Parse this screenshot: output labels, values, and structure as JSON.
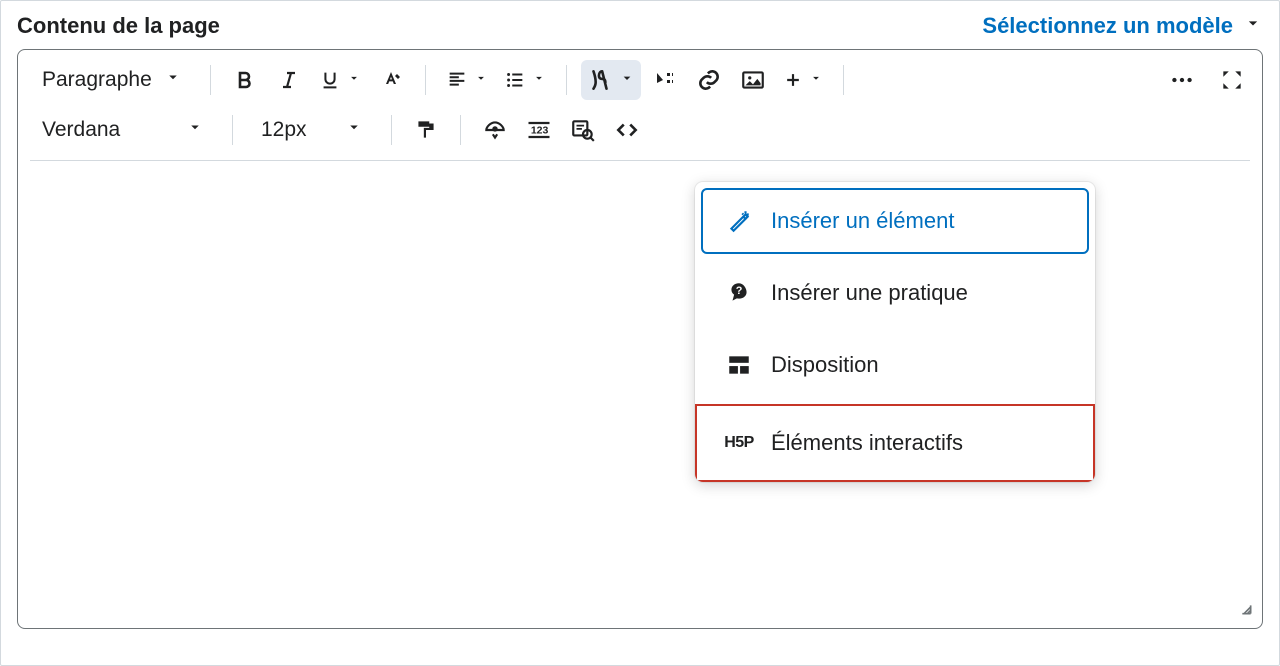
{
  "header": {
    "title": "Contenu de la page",
    "template_link": "Sélectionnez un modèle"
  },
  "toolbar": {
    "paragraph": "Paragraphe",
    "font_family": "Verdana",
    "font_size": "12px"
  },
  "insert_menu": {
    "items": [
      {
        "label": "Insérer un élément"
      },
      {
        "label": "Insérer une pratique"
      },
      {
        "label": "Disposition"
      },
      {
        "label": "Éléments interactifs"
      }
    ]
  }
}
